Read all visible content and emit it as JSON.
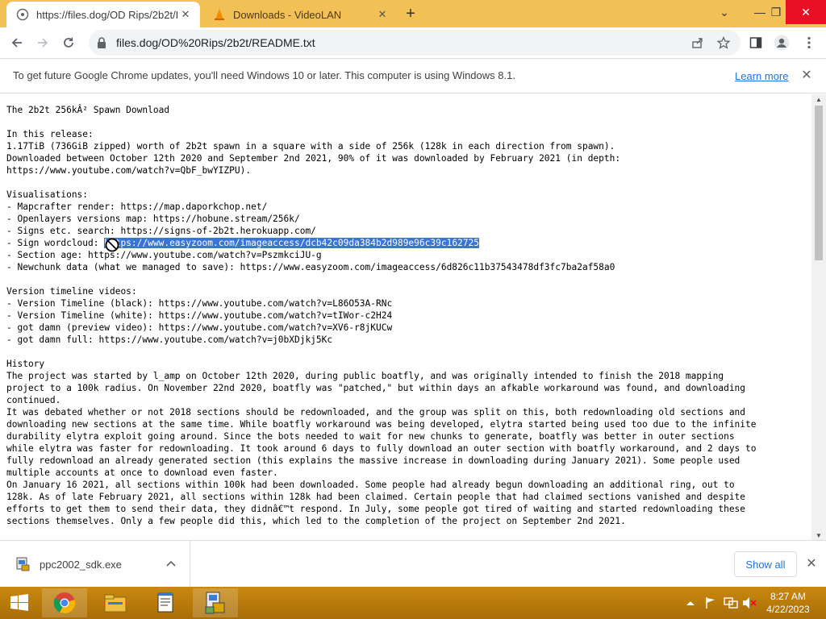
{
  "tabs": [
    {
      "title": "https://files.dog/OD Rips/2b2t/R",
      "active": true,
      "close": "✕"
    },
    {
      "title": "Downloads - VideoLAN",
      "active": false,
      "close": "✕"
    }
  ],
  "new_tab_label": "+",
  "window_controls": {
    "minimize": "—",
    "restore": "❐",
    "close": "✕",
    "tabsearch": "⌄"
  },
  "toolbar": {
    "url": "files.dog/OD%20Rips/2b2t/README.txt"
  },
  "infobar": {
    "message": "To get future Google Chrome updates, you'll need Windows 10 or later. This computer is using Windows 8.1.",
    "link": "Learn more"
  },
  "document": {
    "lines": [
      "The 2b2t 256kÂ² Spawn Download",
      "",
      "In this release:",
      "1.17TiB (736GiB zipped) worth of 2b2t spawn in a square with a side of 256k (128k in each direction from spawn).",
      "Downloaded between October 12th 2020 and September 2nd 2021, 90% of it was downloaded by February 2021 (in depth:",
      "https://www.youtube.com/watch?v=QbF_bwYIZPU).",
      "",
      "Visualisations:",
      "- Mapcrafter render: https://map.daporkchop.net/",
      "- Openlayers versions map: https://hobune.stream/256k/",
      "- Signs etc. search: https://signs-of-2b2t.herokuapp.com/",
      "- Sign wordcloud: ",
      "- Section age: https://www.youtube.com/watch?v=PszmkciJU-g",
      "- Newchunk data (what we managed to save): https://www.easyzoom.com/imageaccess/6d826c11b37543478df3fc7ba2af58a0",
      "",
      "Version timeline videos:",
      "- Version Timeline (black): https://www.youtube.com/watch?v=L86O53A-RNc",
      "- Version Timeline (white): https://www.youtube.com/watch?v=tIWor-c2H24",
      "- got damn (preview video): https://www.youtube.com/watch?v=XV6-r8jKUCw",
      "- got damn full: https://www.youtube.com/watch?v=j0bXDjkj5Kc",
      "",
      "History",
      "The project was started by l_amp on October 12th 2020, during public boatfly, and was originally intended to finish the 2018 mapping",
      "project to a 100k radius. On November 22nd 2020, boatfly was \"patched,\" but within days an afkable workaround was found, and downloading",
      "continued.",
      "It was debated whether or not 2018 sections should be redownloaded, and the group was split on this, both redownloading old sections and",
      "downloading new sections at the same time. While boatfly workaround was being developed, elytra started being used too due to the infinite",
      "durability elytra exploit going around. Since the bots needed to wait for new chunks to generate, boatfly was better in outer sections",
      "while elytra was faster for redownloading. It took around 6 days to fully download an outer section with boatfly workaround, and 2 days to",
      "fully redownload an already generated section (this explains the massive increase in downloading during January 2021). Some people used",
      "multiple accounts at once to download even faster.",
      "On January 16 2021, all sections within 100k had been downloaded. Some people had already begun downloading an additional ring, out to",
      "128k. As of late February 2021, all sections within 128k had been claimed. Certain people that had claimed sections vanished and despite",
      "efforts to get them to send their data, they didnâ€™t respond. In July, some people got tired of waiting and started redownloading these",
      "sections themselves. Only a few people did this, which led to the completion of the project on September 2nd 2021."
    ],
    "selected_text": "https://www.easyzoom.com/imageaccess/dcb42c09da384b2d989e96c39c162725"
  },
  "downloads": {
    "item_name": "ppc2002_sdk.exe",
    "show_all": "Show all"
  },
  "taskbar": {
    "time": "8:27 AM",
    "date": "4/22/2023"
  }
}
